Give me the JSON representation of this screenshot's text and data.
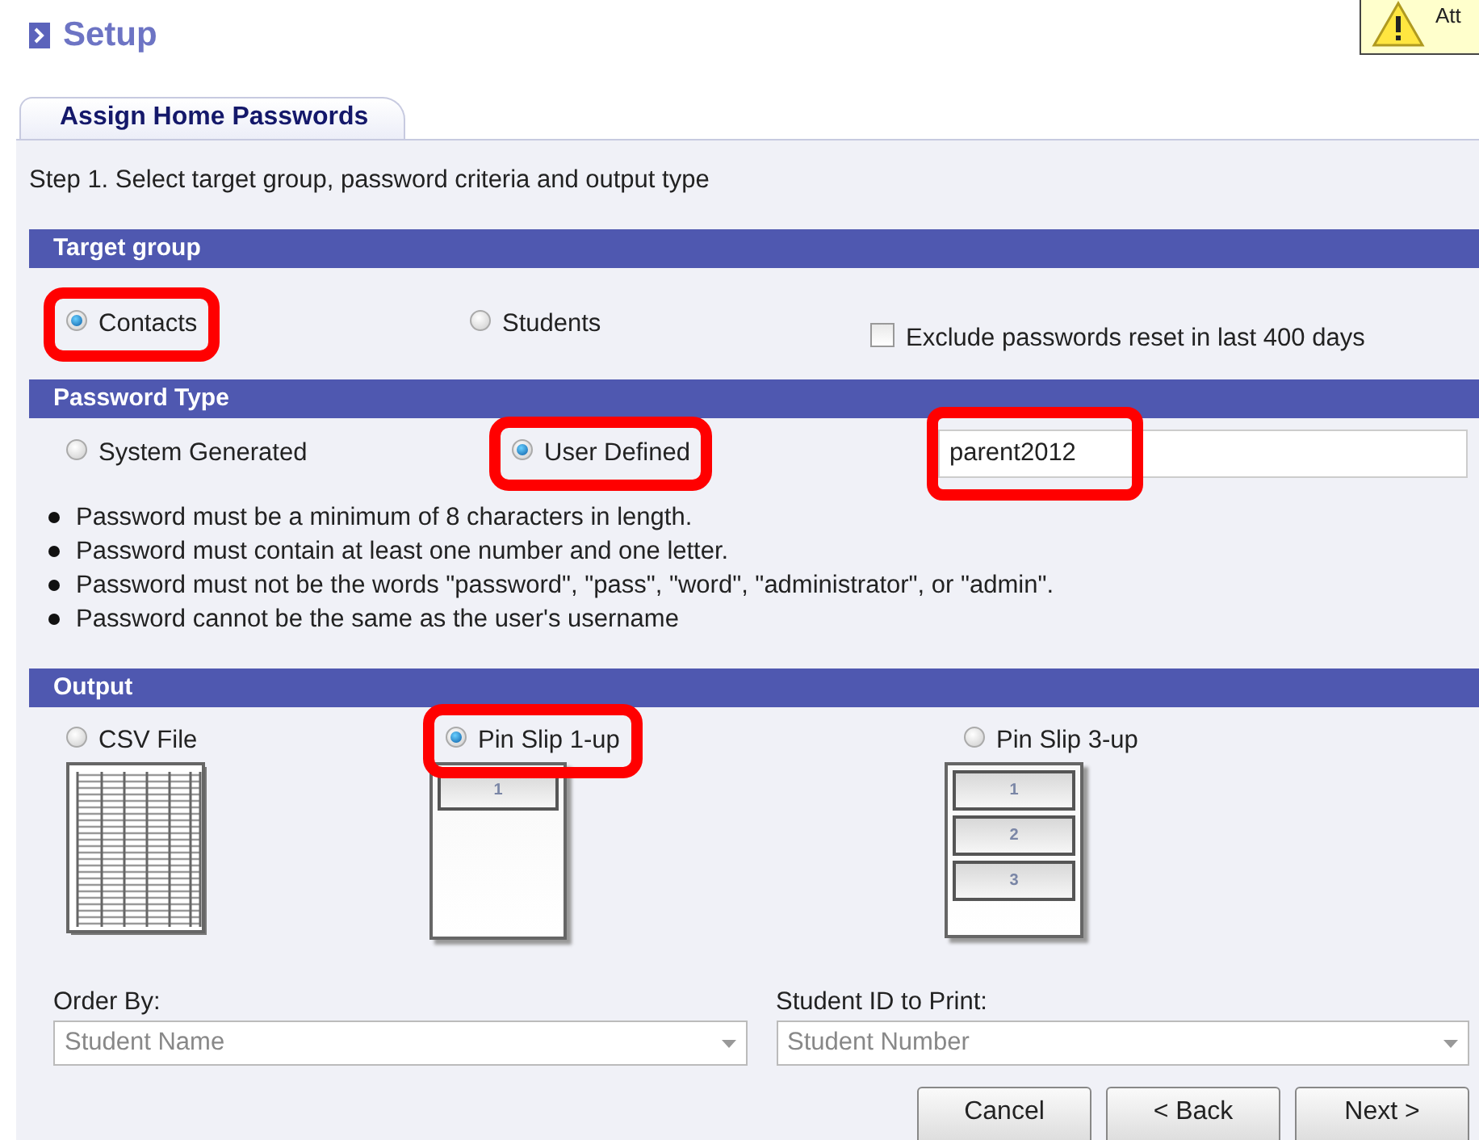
{
  "header": {
    "title": "Setup"
  },
  "alert": {
    "text": "Att"
  },
  "tabs": [
    {
      "label": "Assign Home Passwords",
      "selected": true
    }
  ],
  "step": "Step 1. Select target group, password criteria and output type",
  "target_group": {
    "heading": "Target group",
    "options": [
      {
        "label": "Contacts",
        "selected": true,
        "highlighted": true
      },
      {
        "label": "Students",
        "selected": false,
        "highlighted": false
      }
    ],
    "exclude": {
      "label": "Exclude passwords reset in last 400 days",
      "checked": false
    }
  },
  "password_type": {
    "heading": "Password Type",
    "options": [
      {
        "label": "System Generated",
        "selected": false,
        "highlighted": false
      },
      {
        "label": "User Defined",
        "selected": true,
        "highlighted": true
      }
    ],
    "password": {
      "value": "parent2012",
      "highlighted": true
    },
    "rules": [
      "Password must be a minimum of 8 characters in length.",
      "Password must contain at least one number and one letter.",
      "Password must not be the words \"password\", \"pass\", \"word\", \"administrator\", or \"admin\".",
      "Password cannot be the same as the user's username"
    ]
  },
  "output": {
    "heading": "Output",
    "options": [
      {
        "label": "CSV File",
        "kind": "csv",
        "selected": false,
        "highlighted": false
      },
      {
        "label": "Pin Slip 1-up",
        "kind": "slips",
        "slots": [
          "1"
        ],
        "selected": true,
        "highlighted": true
      },
      {
        "label": "Pin Slip 3-up",
        "kind": "slips",
        "slots": [
          "1",
          "2",
          "3"
        ],
        "selected": false,
        "highlighted": false
      }
    ]
  },
  "order_by": {
    "label": "Order By:",
    "value": "Student Name"
  },
  "student_id": {
    "label": "Student ID to Print:",
    "value": "Student Number"
  },
  "buttons": [
    "Cancel",
    "< Back",
    "Next >"
  ]
}
